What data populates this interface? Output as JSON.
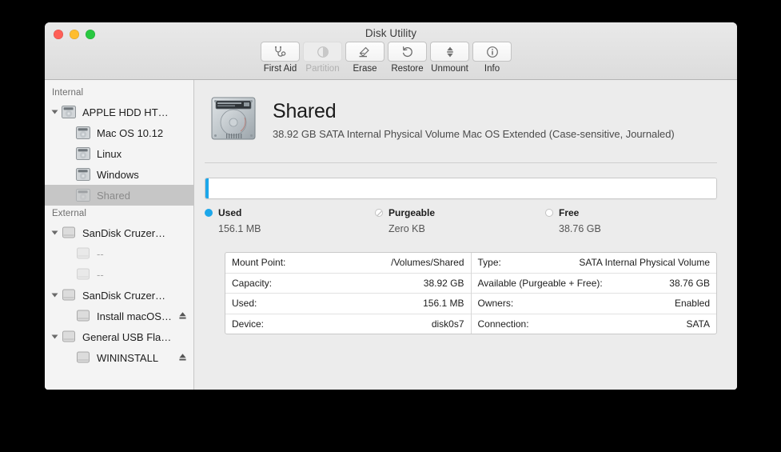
{
  "window": {
    "title": "Disk Utility",
    "traffic_lights": [
      "close-button",
      "minimize-button",
      "zoom-button"
    ]
  },
  "toolbar": {
    "items": [
      {
        "label": "First Aid",
        "icon": "stethoscope-icon",
        "enabled": true
      },
      {
        "label": "Partition",
        "icon": "pie-chart-icon",
        "enabled": false
      },
      {
        "label": "Erase",
        "icon": "erase-disk-icon",
        "enabled": true
      },
      {
        "label": "Restore",
        "icon": "undo-arrow-icon",
        "enabled": true
      },
      {
        "label": "Unmount",
        "icon": "unmount-arrows-icon",
        "enabled": true
      },
      {
        "label": "Info",
        "icon": "info-circle-icon",
        "enabled": true
      }
    ]
  },
  "sidebar": {
    "sections": [
      {
        "header": "Internal",
        "rows": [
          {
            "label": "APPLE HDD HT…",
            "icon": "internal-drive-icon",
            "level": 1,
            "disclosure": true,
            "selected": false,
            "dim": false,
            "eject": false
          },
          {
            "label": "Mac OS 10.12",
            "icon": "internal-drive-icon",
            "level": 2,
            "disclosure": false,
            "selected": false,
            "dim": false,
            "eject": false
          },
          {
            "label": "Linux",
            "icon": "internal-drive-icon",
            "level": 2,
            "disclosure": false,
            "selected": false,
            "dim": false,
            "eject": false
          },
          {
            "label": "Windows",
            "icon": "internal-drive-icon",
            "level": 2,
            "disclosure": false,
            "selected": false,
            "dim": false,
            "eject": false
          },
          {
            "label": "Shared",
            "icon": "internal-drive-icon",
            "level": 2,
            "disclosure": false,
            "selected": true,
            "dim": false,
            "eject": false
          }
        ]
      },
      {
        "header": "External",
        "rows": [
          {
            "label": "SanDisk Cruzer…",
            "icon": "external-drive-icon",
            "level": 1,
            "disclosure": true,
            "selected": false,
            "dim": false,
            "eject": false
          },
          {
            "label": "--",
            "icon": "external-drive-icon",
            "level": 2,
            "disclosure": false,
            "selected": false,
            "dim": true,
            "eject": false
          },
          {
            "label": "--",
            "icon": "external-drive-icon",
            "level": 2,
            "disclosure": false,
            "selected": false,
            "dim": true,
            "eject": false
          },
          {
            "label": "SanDisk Cruzer…",
            "icon": "external-drive-icon",
            "level": 1,
            "disclosure": true,
            "selected": false,
            "dim": false,
            "eject": false
          },
          {
            "label": "Install macOS…",
            "icon": "external-drive-icon",
            "level": 2,
            "disclosure": false,
            "selected": false,
            "dim": false,
            "eject": true
          },
          {
            "label": "General USB Fla…",
            "icon": "external-drive-icon",
            "level": 1,
            "disclosure": true,
            "selected": false,
            "dim": false,
            "eject": false
          },
          {
            "label": "WININSTALL",
            "icon": "external-drive-icon",
            "level": 2,
            "disclosure": false,
            "selected": false,
            "dim": false,
            "eject": true
          }
        ]
      }
    ]
  },
  "detail": {
    "volume_icon": "hard-drive-icon",
    "volume_name": "Shared",
    "volume_subtitle": "38.92 GB SATA Internal Physical Volume Mac OS Extended (Case-sensitive, Journaled)",
    "capacity_bar": {
      "used_percent": 0.4,
      "free_percent": 99.6,
      "used_color": "#1ca7ea",
      "free_color": "#ffffff"
    },
    "legend": [
      {
        "name": "Used",
        "value": "156.1 MB",
        "swatch": "used"
      },
      {
        "name": "Purgeable",
        "value": "Zero KB",
        "swatch": "purge"
      },
      {
        "name": "Free",
        "value": "38.76 GB",
        "swatch": "free"
      }
    ],
    "info_table": {
      "left": [
        {
          "key": "Mount Point:",
          "value": "/Volumes/Shared"
        },
        {
          "key": "Capacity:",
          "value": "38.92 GB"
        },
        {
          "key": "Used:",
          "value": "156.1 MB"
        },
        {
          "key": "Device:",
          "value": "disk0s7"
        }
      ],
      "right": [
        {
          "key": "Type:",
          "value": "SATA Internal Physical Volume"
        },
        {
          "key": "Available (Purgeable + Free):",
          "value": "38.76 GB"
        },
        {
          "key": "Owners:",
          "value": "Enabled"
        },
        {
          "key": "Connection:",
          "value": "SATA"
        }
      ]
    }
  }
}
